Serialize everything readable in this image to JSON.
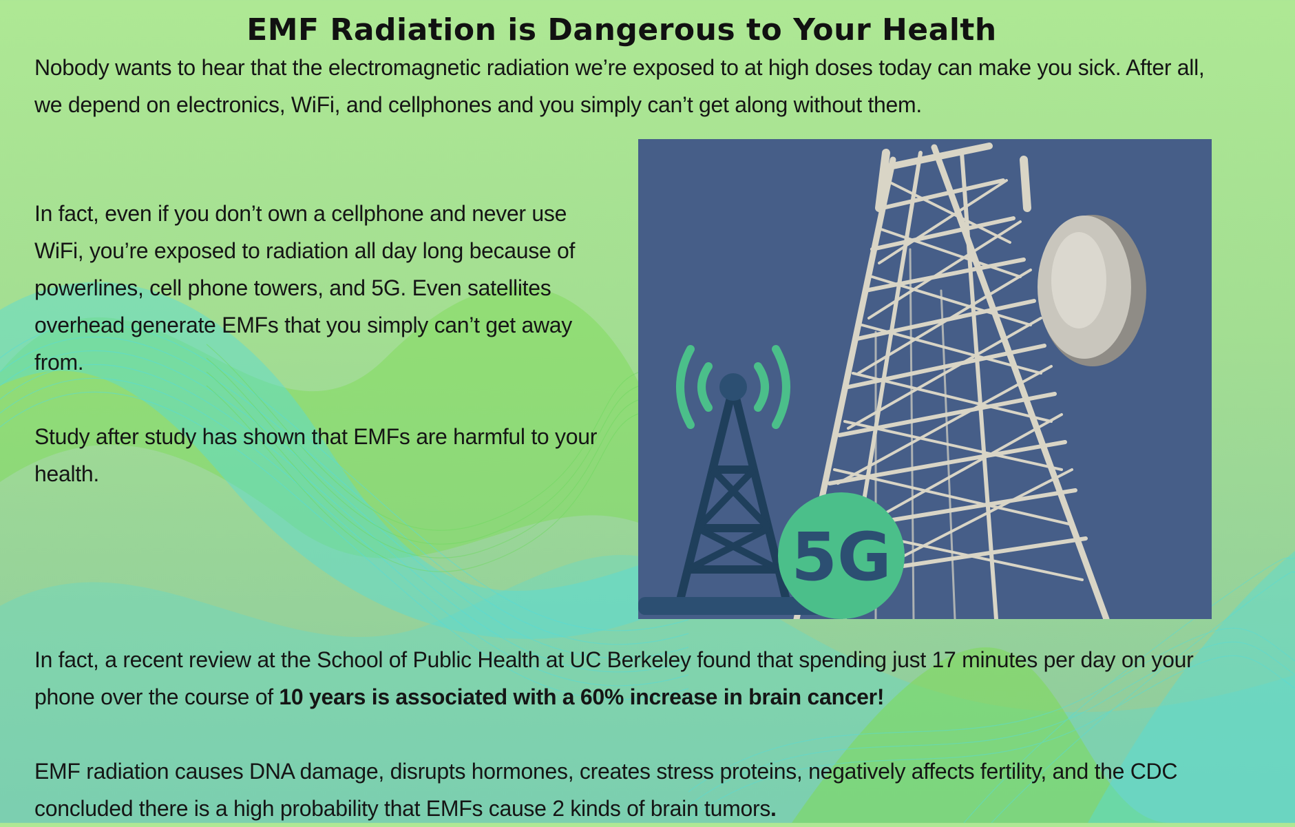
{
  "article": {
    "title": "EMF Radiation is Dangerous to Your Health",
    "intro": "Nobody wants to hear that the electromagnetic radiation we’re exposed to at high doses today can make you sick. After all, we depend on electronics, WiFi, and cellphones and you simply can’t get along without them.",
    "exposure": "In fact, even if you don’t own a cellphone and never use WiFi, you’re exposed to radiation all day long because of powerlines, cell phone towers, and 5G. Even satellites overhead generate EMFs that you simply can’t get away from.",
    "studies": "Study after study has shown that EMFs are harmful to your health.",
    "berkeley_text": "In fact, a recent review at the School of Public Health at UC Berkeley found that spending just 17 minutes per day on your phone over the course of ",
    "berkeley_bold": "10 years is associated with a 60% increase in brain cancer!",
    "effects_text": "EMF radiation causes DNA damage, disrupts hormones, creates stress proteins, negatively affects fertility, and the CDC concluded there is a high probability that EMFs cause 2 kinds of brain tumors",
    "effects_end": "."
  },
  "image": {
    "badge_text": "5G",
    "colors": {
      "sky": "#465e88",
      "badge": "#4bbf8a",
      "tower_icon": "#1f3f5b",
      "signal_waves": "#4bbf8a",
      "steel": "#d9d5c6"
    }
  },
  "colors": {
    "background_top": "#aee894",
    "background_bottom": "#8cc9a0",
    "wave_cyan": "#56dcd8",
    "wave_green": "#7ddb55"
  }
}
